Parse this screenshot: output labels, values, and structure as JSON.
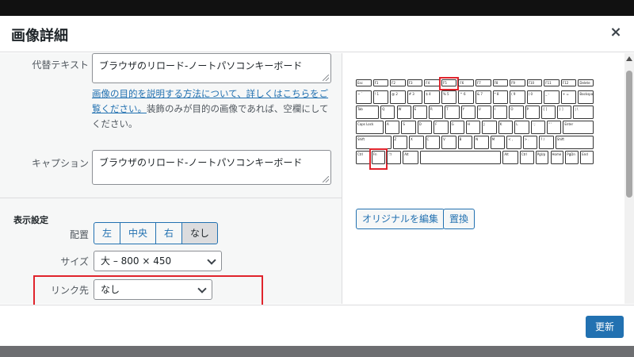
{
  "modal": {
    "title": "画像詳細",
    "close_label": "×"
  },
  "alt_text": {
    "label": "代替テキスト",
    "value": "ブラウザのリロード-ノートパソコンキーボード",
    "help_link": "画像の目的を説明する方法について、詳しくはこちらをご覧ください。",
    "help_rest": "装飾のみが目的の画像であれば、空欄にしてください。"
  },
  "caption": {
    "label": "キャプション",
    "value": "ブラウザのリロード-ノートパソコンキーボード"
  },
  "display_settings": {
    "title": "表示設定",
    "align_label": "配置",
    "align_options": [
      "左",
      "中央",
      "右",
      "なし"
    ],
    "align_selected": "なし",
    "size_label": "サイズ",
    "size_value": "大 – 800 × 450",
    "link_label": "リンク先",
    "link_value": "なし"
  },
  "image_actions": {
    "edit_original": "オリジナルを編集",
    "replace": "置換"
  },
  "footer": {
    "update_button": "更新"
  },
  "keyboard": {
    "highlight_color": "#e0242c",
    "highlighted_keys": [
      "F5",
      "Fn"
    ],
    "rows": [
      [
        "Esc",
        "F1",
        "F2",
        "F3",
        "F4",
        "F5",
        "F6",
        "F7",
        "F8",
        "F9",
        "F10",
        "F11",
        "F12",
        "Delete"
      ],
      [
        "~ `",
        "! 1",
        "@ 2",
        "# 3",
        "$ 4",
        "% 5",
        "^ 6",
        "& 7",
        "* 8",
        "( 9",
        ") 0",
        "_ -",
        "+ =",
        "Backspace"
      ],
      [
        "Tab",
        "Q",
        "W",
        "E",
        "R",
        "T",
        "Y",
        "U",
        "I",
        "O",
        "P",
        "{ [",
        "} ]",
        "| \\"
      ],
      [
        "Caps Lock",
        "A",
        "S",
        "D",
        "F",
        "G",
        "H",
        "J",
        "K",
        "L",
        ": ;",
        "\" '",
        "Enter"
      ],
      [
        "Shift",
        "Z",
        "X",
        "C",
        "V",
        "B",
        "N",
        "M",
        "< ,",
        "> .",
        "? /",
        "Shift"
      ],
      [
        "Ctrl",
        "Fn",
        "❐",
        "Alt",
        "",
        "Alt",
        "Ctrl",
        "PgUp",
        "Home",
        "PgDn",
        "End"
      ]
    ]
  },
  "colors": {
    "accent": "#2271b1",
    "highlight_box": "#e0242c"
  }
}
